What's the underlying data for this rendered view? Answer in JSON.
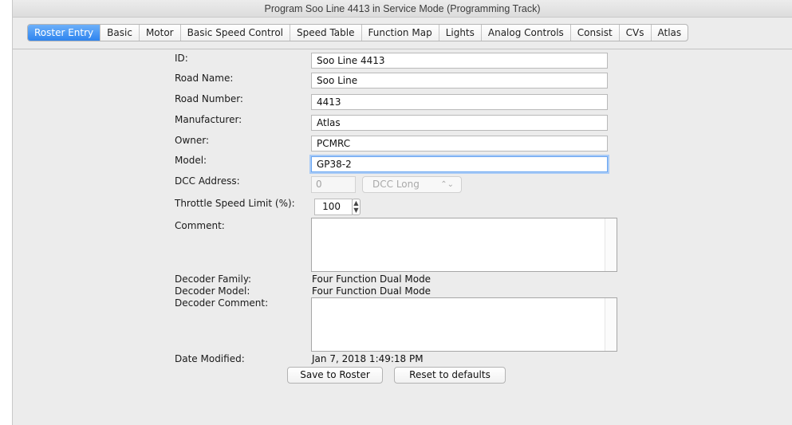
{
  "window": {
    "title": "Program Soo Line 4413 in Service Mode (Programming Track)"
  },
  "tabs": [
    {
      "label": "Roster Entry",
      "active": true
    },
    {
      "label": "Basic"
    },
    {
      "label": "Motor"
    },
    {
      "label": "Basic Speed Control"
    },
    {
      "label": "Speed Table"
    },
    {
      "label": "Function Map"
    },
    {
      "label": "Lights"
    },
    {
      "label": "Analog Controls"
    },
    {
      "label": "Consist"
    },
    {
      "label": "CVs"
    },
    {
      "label": "Atlas"
    }
  ],
  "form": {
    "id_label": "ID:",
    "id_value": "Soo Line 4413",
    "road_name_label": "Road Name:",
    "road_name_value": "Soo Line",
    "road_number_label": "Road Number:",
    "road_number_value": "4413",
    "manufacturer_label": "Manufacturer:",
    "manufacturer_value": "Atlas",
    "owner_label": "Owner:",
    "owner_value": "PCMRC",
    "model_label": "Model:",
    "model_value": "GP38-2",
    "dcc_address_label": "DCC Address:",
    "dcc_address_value": "0",
    "dcc_type_value": "DCC Long",
    "throttle_limit_label": "Throttle Speed Limit (%):",
    "throttle_limit_value": "100",
    "comment_label": "Comment:",
    "decoder_family_label": "Decoder Family:",
    "decoder_family_value": "Four Function Dual Mode",
    "decoder_model_label": "Decoder Model:",
    "decoder_model_value": "Four Function Dual Mode",
    "decoder_comment_label": "Decoder Comment:",
    "date_modified_label": "Date Modified:",
    "date_modified_value": "Jan 7, 2018 1:49:18 PM"
  },
  "buttons": {
    "save": "Save to Roster",
    "reset": "Reset to defaults"
  },
  "colors": {
    "accent": "#2e84ef",
    "focus_ring": "#a9cbf6"
  }
}
